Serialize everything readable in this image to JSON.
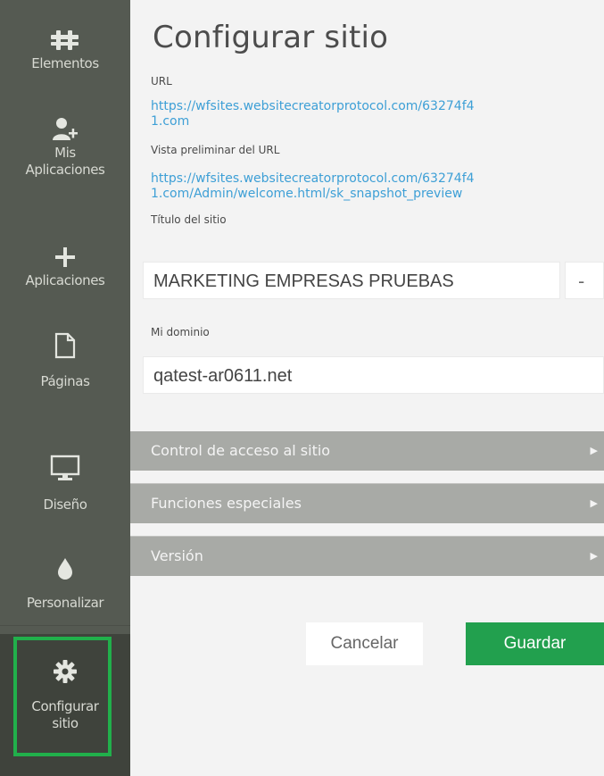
{
  "sidebar": {
    "items": [
      {
        "label": "Elementos",
        "icon": "blocks-icon"
      },
      {
        "label": "Mis Aplicaciones",
        "icon": "user-add-icon"
      },
      {
        "label": "Aplicaciones",
        "icon": "plus-icon"
      },
      {
        "label": "Páginas",
        "icon": "page-icon"
      },
      {
        "label": "Diseño",
        "icon": "monitor-icon"
      },
      {
        "label": "Personalizar",
        "icon": "drop-icon"
      },
      {
        "label": "Configurar sitio",
        "icon": "gear-icon"
      }
    ],
    "highlight_color": "#21b04b"
  },
  "panel": {
    "title": "Configurar sitio",
    "url_label": "URL",
    "url_line1": "https://wfsites.websitecreatorprotocol.com/63274f4",
    "url_line2": "1.com",
    "preview_label": "Vista preliminar del URL",
    "preview_line1": "https://wfsites.websitecreatorprotocol.com/63274f4",
    "preview_line2": "1.com/Admin/welcome.html/sk_snapshot_preview",
    "site_title_label": "Título del sitio",
    "site_title_value": "MARKETING EMPRESAS PRUEBAS",
    "dash": "-",
    "domain_label": "Mi dominio",
    "domain_value": "qatest-ar0611.net",
    "sections": [
      {
        "label": "Control de acceso al sitio"
      },
      {
        "label": "Funciones especiales"
      },
      {
        "label": "Versión"
      }
    ],
    "cancel_label": "Cancelar",
    "save_label": "Guardar"
  },
  "colors": {
    "sidebar_bg": "#555a52",
    "link": "#3d9fd6",
    "accordion_bg": "#a8aaa6",
    "save_bg": "#22a04e"
  }
}
